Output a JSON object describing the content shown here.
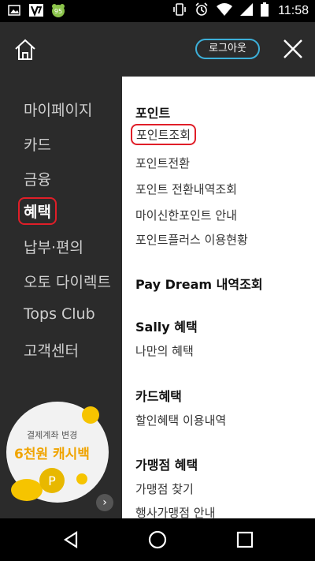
{
  "status_bar": {
    "time": "11:58",
    "badge": "95",
    "icons": [
      "gallery-icon",
      "app-v-icon",
      "frog-icon",
      "vibrate-icon",
      "alarm-icon",
      "wifi-icon",
      "signal-icon",
      "battery-icon"
    ]
  },
  "header": {
    "logout_label": "로그아웃",
    "accent_color": "#3db0d9"
  },
  "left_menu": {
    "items": [
      {
        "label": "마이페이지"
      },
      {
        "label": "카드"
      },
      {
        "label": "금융"
      },
      {
        "label": "혜택",
        "active": true
      },
      {
        "label": "납부·편의"
      },
      {
        "label": "오토 다이렉트"
      },
      {
        "label": "Tops Club"
      },
      {
        "label": "고객센터"
      }
    ],
    "promo": {
      "line1": "결제계좌 변경",
      "line2": "6천원 캐시백"
    }
  },
  "right_panel": {
    "sections": [
      {
        "title": "포인트",
        "links": [
          "포인트조회",
          "포인트전환",
          "포인트 전환내역조회",
          "마이신한포인트 안내",
          "포인트플러스 이용현황"
        ]
      },
      {
        "title": "Pay Dream 내역조회",
        "links": []
      },
      {
        "title": "Sally 혜택",
        "links": [
          "나만의 혜택"
        ]
      },
      {
        "title": "카드혜택",
        "links": [
          "할인혜택 이용내역"
        ]
      },
      {
        "title": "가맹점 혜택",
        "links": [
          "가맹점 찾기",
          "행사가맹점 안내"
        ]
      }
    ],
    "highlight_color": "#e01e28"
  }
}
